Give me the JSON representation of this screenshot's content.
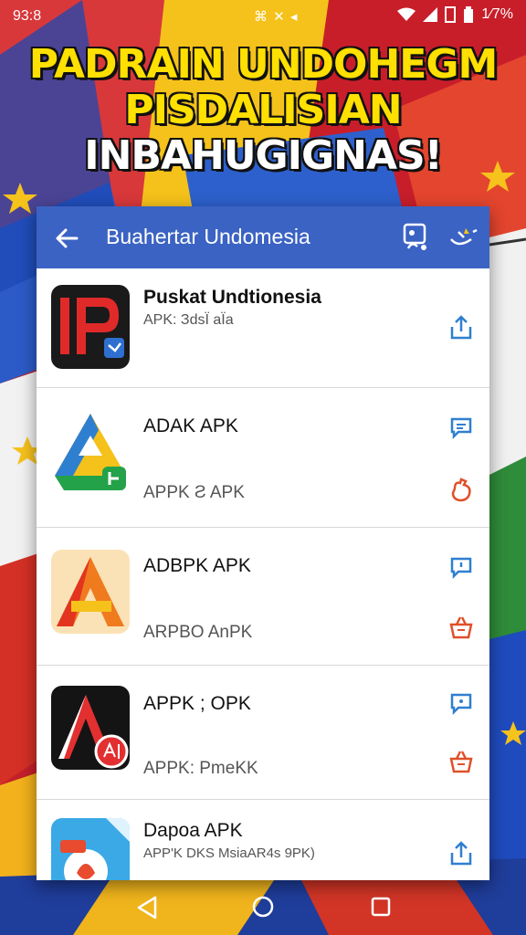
{
  "status_bar": {
    "time": "93:8",
    "center_icons": "⌘ ✕ ◂",
    "battery_text": "1⁄7%"
  },
  "headline": {
    "line1": "PADRAIN UNDOHEGM",
    "line2": "PISDALISIAN",
    "line3": "INBAHUGIGNAS!"
  },
  "toolbar": {
    "title": "Buahertar Undomesia",
    "color": "#3b63c3"
  },
  "apps": [
    {
      "name": "Puskat Undtionesia",
      "subtitle": "APK: ЗdsЇ aЇa",
      "action_icon": "share-icon"
    },
    {
      "name": "ADAK APK",
      "subtitle": "APPK Ƨ APK",
      "action_icons": [
        "comment-icon",
        "hand-icon"
      ]
    },
    {
      "name": "ADBPK APK",
      "subtitle": "ARPBO AnPK",
      "action_icons": [
        "comment-icon",
        "basket-icon"
      ]
    },
    {
      "name": "APPK ; OPK",
      "subtitle": "APPK: PmeKK",
      "action_icons": [
        "comment-icon",
        "basket-icon"
      ]
    },
    {
      "name": "Dapoa APK",
      "subtitle": "APP'K DKS MsiaAR4s 9PK)",
      "action_icon": "share-icon"
    }
  ],
  "colors": {
    "accent_blue": "#3b63c3",
    "action_blue": "#2f7fd0",
    "action_orange": "#e0502a"
  }
}
